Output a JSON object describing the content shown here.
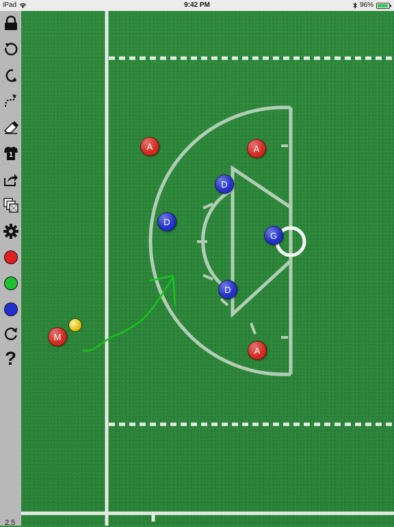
{
  "status_bar": {
    "device": "iPad",
    "time": "9:42 PM",
    "battery": "96%",
    "battery_level": 0.96
  },
  "toolbar": {
    "tools": [
      {
        "name": "lock-icon"
      },
      {
        "name": "undo-icon"
      },
      {
        "name": "redo-icon"
      },
      {
        "name": "path-icon"
      },
      {
        "name": "eraser-icon"
      },
      {
        "name": "jersey-icon",
        "label": "1"
      },
      {
        "name": "share-icon"
      },
      {
        "name": "layers-icon"
      },
      {
        "name": "gear-icon"
      },
      {
        "name": "red-color",
        "color": "#e02020"
      },
      {
        "name": "green-color",
        "color": "#1fbf2f"
      },
      {
        "name": "blue-color",
        "color": "#2030d0"
      },
      {
        "name": "reset-icon"
      },
      {
        "name": "help-icon",
        "label": "?"
      }
    ],
    "version": "2.5"
  },
  "field": {
    "colors": {
      "red": "#d42a22",
      "blue": "#2231c9",
      "line": "#e8e8e8",
      "arrow": "#16c41c"
    },
    "players": [
      {
        "label": "A",
        "team": "red"
      },
      {
        "label": "A",
        "team": "red"
      },
      {
        "label": "D",
        "team": "blue"
      },
      {
        "label": "D",
        "team": "blue"
      },
      {
        "label": "G",
        "team": "blue"
      },
      {
        "label": "D",
        "team": "blue"
      },
      {
        "label": "A",
        "team": "red"
      },
      {
        "label": "M",
        "team": "red"
      }
    ]
  }
}
